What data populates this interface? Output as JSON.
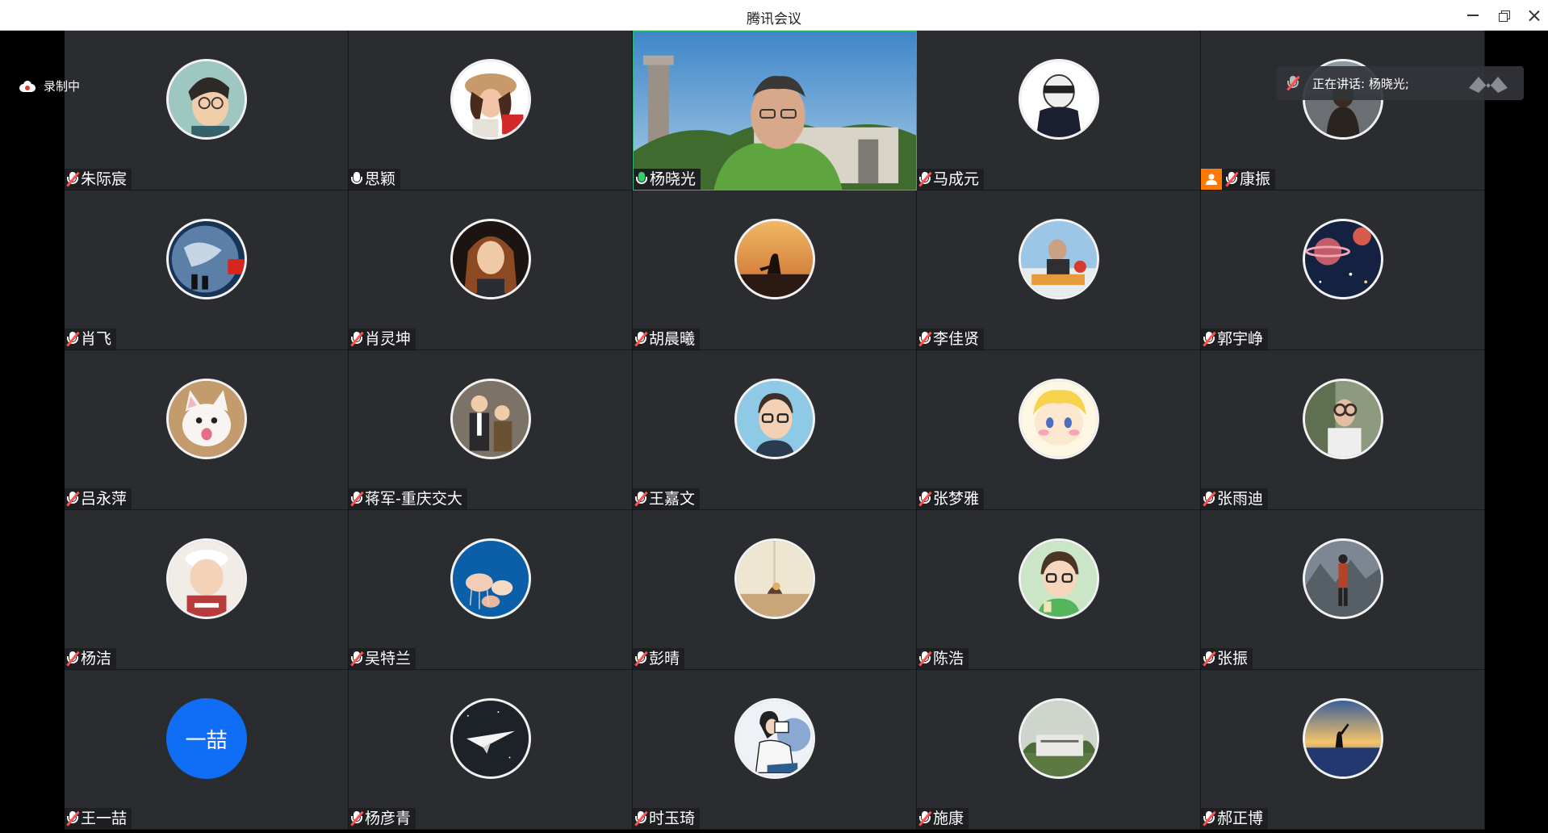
{
  "window": {
    "title": "腾讯会议"
  },
  "recording": {
    "label": "录制中"
  },
  "speaking": {
    "label": "正在讲话: 杨晓光;"
  },
  "participants": [
    {
      "name": "朱际宸",
      "mic": "muted",
      "avatar": "anime-boy-glasses"
    },
    {
      "name": "思颖",
      "mic": "on",
      "avatar": "girl-hat"
    },
    {
      "name": "杨晓光",
      "mic": "active",
      "avatar": "video"
    },
    {
      "name": "马成元",
      "mic": "muted",
      "avatar": "anime-blindfold"
    },
    {
      "name": "康振",
      "mic": "muted",
      "avatar": "person-back",
      "host": true
    },
    {
      "name": "肖飞",
      "mic": "muted",
      "avatar": "earth-flag"
    },
    {
      "name": "肖灵坤",
      "mic": "muted",
      "avatar": "girl-hair"
    },
    {
      "name": "胡晨曦",
      "mic": "muted",
      "avatar": "sunset-silhouette"
    },
    {
      "name": "李佳贤",
      "mic": "muted",
      "avatar": "man-food"
    },
    {
      "name": "郭宇峥",
      "mic": "muted",
      "avatar": "space-planet"
    },
    {
      "name": "吕永萍",
      "mic": "muted",
      "avatar": "white-cat"
    },
    {
      "name": "蒋军-重庆交大",
      "mic": "muted",
      "avatar": "two-kids"
    },
    {
      "name": "王嘉文",
      "mic": "muted",
      "avatar": "cartoon-glasses"
    },
    {
      "name": "张梦雅",
      "mic": "muted",
      "avatar": "cartoon-blonde"
    },
    {
      "name": "张雨迪",
      "mic": "muted",
      "avatar": "man-hands"
    },
    {
      "name": "杨洁",
      "mic": "muted",
      "avatar": "child-hat"
    },
    {
      "name": "吴特兰",
      "mic": "muted",
      "avatar": "jellyfish"
    },
    {
      "name": "彭晴",
      "mic": "muted",
      "avatar": "still-life"
    },
    {
      "name": "陈浩",
      "mic": "muted",
      "avatar": "cartoon-boy-green"
    },
    {
      "name": "张振",
      "mic": "muted",
      "avatar": "mountain-hiker"
    },
    {
      "name": "王一喆",
      "mic": "muted",
      "avatar": "initials",
      "initials": "一喆"
    },
    {
      "name": "杨彦青",
      "mic": "muted",
      "avatar": "paper-plane"
    },
    {
      "name": "时玉琦",
      "mic": "muted",
      "avatar": "girl-reading"
    },
    {
      "name": "施康",
      "mic": "muted",
      "avatar": "stone-sign"
    },
    {
      "name": "郝正博",
      "mic": "muted",
      "avatar": "sunset-lake"
    }
  ],
  "colors": {
    "tile": "#2b2c30",
    "accent_initials": "#0f6ef5",
    "active_border": "#2bb673",
    "host_badge": "#ff7a00",
    "mute_slash": "#ff4f4f"
  }
}
